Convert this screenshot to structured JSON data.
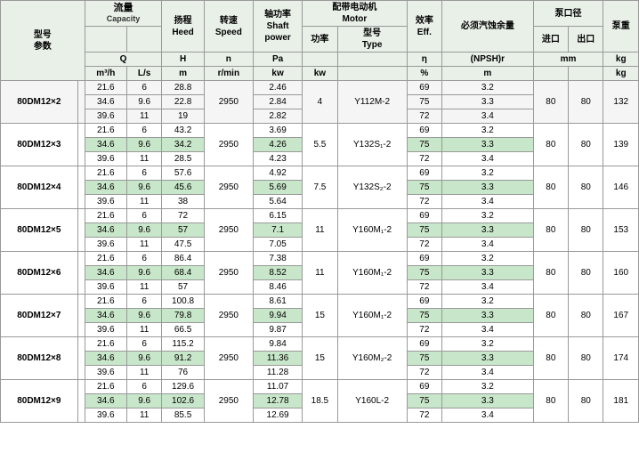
{
  "headers": {
    "col1_label1": "型号",
    "col1_label2": "参数",
    "col2_label1": "流量",
    "col2_label2": "Capacity",
    "col2_unit": "Q",
    "col2_unit2": "m³/h",
    "col2_unit3": "L/s",
    "col3_label1": "扬程",
    "col3_label2": "Heed",
    "col3_unit": "H",
    "col3_unit2": "m",
    "col4_label1": "转速",
    "col4_label2": "Speed",
    "col4_unit": "n",
    "col4_unit2": "r/min",
    "col5_label1": "轴功率",
    "col5_label2": "Shaft",
    "col5_label3": "power",
    "col5_unit": "Pa",
    "col5_unit2": "kw",
    "col6_label1": "配带电动机",
    "col6_label2": "Motor",
    "col6a_label": "功率",
    "col6a_unit": "kw",
    "col6b_label": "型号",
    "col6b_label2": "Type",
    "col7_label1": "效率",
    "col7_label2": "Eff.",
    "col7_unit": "η",
    "col7_unit2": "%",
    "col8_label1": "必须汽蚀余量",
    "col8_unit": "(NPSH)r",
    "col8_unit2": "m",
    "col9_label1": "泵口径",
    "col9a_label": "进口",
    "col9b_label": "出口",
    "col9_unit": "mm",
    "col10_label1": "泵重",
    "col10_unit": "kg"
  },
  "rows": [
    {
      "model": "80DM12×2",
      "q_m3h": "21.6",
      "q_ls": "6",
      "h": "28.8",
      "n": "",
      "pa": "2.46",
      "power": "",
      "motor": "",
      "eff": "69",
      "npsh": "3.2",
      "inlet": "",
      "outlet": "",
      "weight": ""
    },
    {
      "model": "",
      "q_m3h": "34.6",
      "q_ls": "9.6",
      "h": "22.8",
      "n": "2950",
      "pa": "2.84",
      "power": "4",
      "motor": "Y112M-2",
      "eff": "75",
      "npsh": "3.3",
      "inlet": "80",
      "outlet": "80",
      "weight": "132"
    },
    {
      "model": "",
      "q_m3h": "39.6",
      "q_ls": "11",
      "h": "19",
      "n": "",
      "pa": "2.82",
      "power": "",
      "motor": "",
      "eff": "72",
      "npsh": "3.4",
      "inlet": "",
      "outlet": "",
      "weight": ""
    },
    {
      "model": "80DM12×3",
      "q_m3h": "21.6",
      "q_ls": "6",
      "h": "43.2",
      "n": "",
      "pa": "3.69",
      "power": "",
      "motor": "",
      "eff": "69",
      "npsh": "3.2",
      "inlet": "",
      "outlet": "",
      "weight": ""
    },
    {
      "model": "",
      "q_m3h": "34.6",
      "q_ls": "9.6",
      "h": "34.2",
      "n": "2950",
      "pa": "4.26",
      "power": "5.5",
      "motor": "Y132S₁-2",
      "eff": "75",
      "npsh": "3.3",
      "inlet": "80",
      "outlet": "80",
      "weight": "139"
    },
    {
      "model": "",
      "q_m3h": "39.6",
      "q_ls": "11",
      "h": "28.5",
      "n": "",
      "pa": "4.23",
      "power": "",
      "motor": "",
      "eff": "72",
      "npsh": "3.4",
      "inlet": "",
      "outlet": "",
      "weight": ""
    },
    {
      "model": "80DM12×4",
      "q_m3h": "21.6",
      "q_ls": "6",
      "h": "57.6",
      "n": "",
      "pa": "4.92",
      "power": "",
      "motor": "",
      "eff": "69",
      "npsh": "3.2",
      "inlet": "",
      "outlet": "",
      "weight": ""
    },
    {
      "model": "",
      "q_m3h": "34.6",
      "q_ls": "9.6",
      "h": "45.6",
      "n": "2950",
      "pa": "5.69",
      "power": "7.5",
      "motor": "Y132S₂-2",
      "eff": "75",
      "npsh": "3.3",
      "inlet": "80",
      "outlet": "80",
      "weight": "146"
    },
    {
      "model": "",
      "q_m3h": "39.6",
      "q_ls": "11",
      "h": "38",
      "n": "",
      "pa": "5.64",
      "power": "",
      "motor": "",
      "eff": "72",
      "npsh": "3.4",
      "inlet": "",
      "outlet": "",
      "weight": ""
    },
    {
      "model": "80DM12×5",
      "q_m3h": "21.6",
      "q_ls": "6",
      "h": "72",
      "n": "",
      "pa": "6.15",
      "power": "",
      "motor": "",
      "eff": "69",
      "npsh": "3.2",
      "inlet": "",
      "outlet": "",
      "weight": ""
    },
    {
      "model": "",
      "q_m3h": "34.6",
      "q_ls": "9.6",
      "h": "57",
      "n": "2950",
      "pa": "7.1",
      "power": "11",
      "motor": "Y160M₁-2",
      "eff": "75",
      "npsh": "3.3",
      "inlet": "80",
      "outlet": "80",
      "weight": "153"
    },
    {
      "model": "",
      "q_m3h": "39.6",
      "q_ls": "11",
      "h": "47.5",
      "n": "",
      "pa": "7.05",
      "power": "",
      "motor": "",
      "eff": "72",
      "npsh": "3.4",
      "inlet": "",
      "outlet": "",
      "weight": ""
    },
    {
      "model": "80DM12×6",
      "q_m3h": "21.6",
      "q_ls": "6",
      "h": "86.4",
      "n": "",
      "pa": "7.38",
      "power": "",
      "motor": "",
      "eff": "69",
      "npsh": "3.2",
      "inlet": "",
      "outlet": "",
      "weight": ""
    },
    {
      "model": "",
      "q_m3h": "34.6",
      "q_ls": "9.6",
      "h": "68.4",
      "n": "2950",
      "pa": "8.52",
      "power": "11",
      "motor": "Y160M₁-2",
      "eff": "75",
      "npsh": "3.3",
      "inlet": "80",
      "outlet": "80",
      "weight": "160"
    },
    {
      "model": "",
      "q_m3h": "39.6",
      "q_ls": "11",
      "h": "57",
      "n": "",
      "pa": "8.46",
      "power": "",
      "motor": "",
      "eff": "72",
      "npsh": "3.4",
      "inlet": "",
      "outlet": "",
      "weight": ""
    },
    {
      "model": "80DM12×7",
      "q_m3h": "21.6",
      "q_ls": "6",
      "h": "100.8",
      "n": "",
      "pa": "8.61",
      "power": "",
      "motor": "",
      "eff": "69",
      "npsh": "3.2",
      "inlet": "",
      "outlet": "",
      "weight": ""
    },
    {
      "model": "",
      "q_m3h": "34.6",
      "q_ls": "9.6",
      "h": "79.8",
      "n": "2950",
      "pa": "9.94",
      "power": "15",
      "motor": "Y160M₁-2",
      "eff": "75",
      "npsh": "3.3",
      "inlet": "80",
      "outlet": "80",
      "weight": "167"
    },
    {
      "model": "",
      "q_m3h": "39.6",
      "q_ls": "11",
      "h": "66.5",
      "n": "",
      "pa": "9.87",
      "power": "",
      "motor": "",
      "eff": "72",
      "npsh": "3.4",
      "inlet": "",
      "outlet": "",
      "weight": ""
    },
    {
      "model": "80DM12×8",
      "q_m3h": "21.6",
      "q_ls": "6",
      "h": "115.2",
      "n": "",
      "pa": "9.84",
      "power": "",
      "motor": "",
      "eff": "69",
      "npsh": "3.2",
      "inlet": "",
      "outlet": "",
      "weight": ""
    },
    {
      "model": "",
      "q_m3h": "34.6",
      "q_ls": "9.6",
      "h": "91.2",
      "n": "2950",
      "pa": "11.36",
      "power": "15",
      "motor": "Y160M₂-2",
      "eff": "75",
      "npsh": "3.3",
      "inlet": "80",
      "outlet": "80",
      "weight": "174"
    },
    {
      "model": "",
      "q_m3h": "39.6",
      "q_ls": "11",
      "h": "76",
      "n": "",
      "pa": "11.28",
      "power": "",
      "motor": "",
      "eff": "72",
      "npsh": "3.4",
      "inlet": "",
      "outlet": "",
      "weight": ""
    },
    {
      "model": "80DM12×9",
      "q_m3h": "21.6",
      "q_ls": "6",
      "h": "129.6",
      "n": "",
      "pa": "11.07",
      "power": "",
      "motor": "",
      "eff": "69",
      "npsh": "3.2",
      "inlet": "",
      "outlet": "",
      "weight": ""
    },
    {
      "model": "",
      "q_m3h": "34.6",
      "q_ls": "9.6",
      "h": "102.6",
      "n": "2950",
      "pa": "12.78",
      "power": "18.5",
      "motor": "Y160L-2",
      "eff": "75",
      "npsh": "3.3",
      "inlet": "80",
      "outlet": "80",
      "weight": "181"
    },
    {
      "model": "",
      "q_m3h": "39.6",
      "q_ls": "11",
      "h": "85.5",
      "n": "",
      "pa": "12.69",
      "power": "",
      "motor": "",
      "eff": "72",
      "npsh": "3.4",
      "inlet": "",
      "outlet": "",
      "weight": ""
    }
  ]
}
